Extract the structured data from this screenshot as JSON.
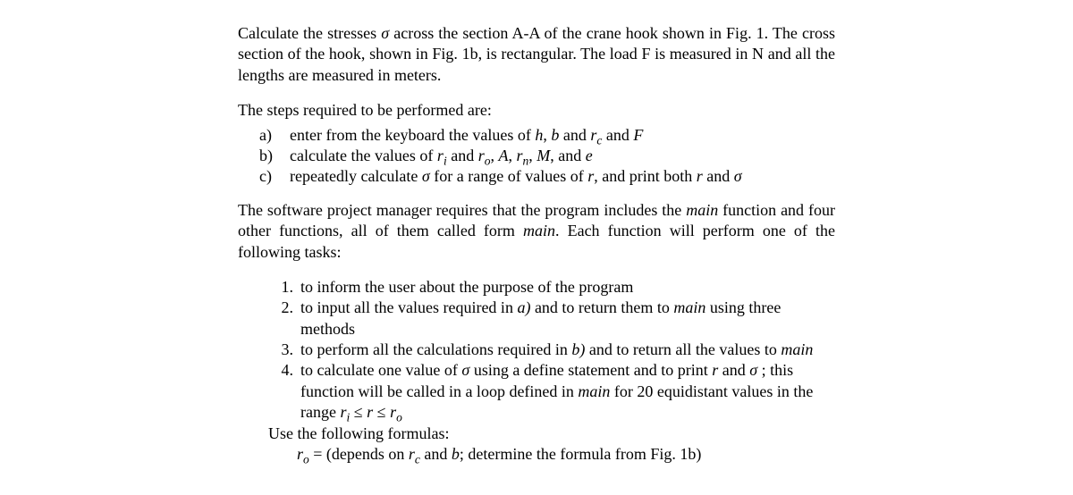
{
  "intro": {
    "p1_a": "Calculate the stresses ",
    "sigma1": "σ",
    "p1_b": " across the section A-A of the crane hook shown in Fig. 1. The cross section of the hook, shown in Fig. 1b, is rectangular.  The load F is measured in N and all the lengths are measured in meters."
  },
  "stepsHeader": "The steps required to be performed are:",
  "steps": {
    "a": {
      "marker": "a)",
      "pre": "enter from the keyboard the values of ",
      "h": "h",
      "comma1": ", ",
      "b": "b",
      "and1": " and ",
      "rc": "r",
      "rc_sub": "c",
      "and2": " and ",
      "F": "F"
    },
    "b": {
      "marker": "b)",
      "pre": "calculate the values of ",
      "ri": "r",
      "ri_sub": "i",
      "and1": " and ",
      "ro": "r",
      "ro_sub": "o",
      "c1": ", ",
      "A": "A",
      "c2": ", ",
      "rn": "r",
      "rn_sub": "n",
      "c3": ", ",
      "M": "M",
      "c4": ", and ",
      "e": "e"
    },
    "c": {
      "marker": "c)",
      "pre": "repeatedly calculate ",
      "sigma": "σ",
      "mid": " for a range of values of ",
      "r": "r",
      "mid2": ", and print both ",
      "r2": "r",
      "and": " and ",
      "sigma2": "σ"
    }
  },
  "pmPara": {
    "a": "The software project manager requires that the program includes the ",
    "main1": "main",
    "b": " function and four other functions, all of them called form ",
    "main2": "main",
    "c": ".  Each function will perform one of the following tasks:"
  },
  "tasks": {
    "t1": {
      "marker": "1.",
      "text": "to inform the user about the purpose of the program"
    },
    "t2": {
      "marker": "2.",
      "pre": "to input all the values required in ",
      "a": "a)",
      "post": " and to return them to ",
      "main": "main",
      "post2": " using three methods"
    },
    "t3": {
      "marker": "3.",
      "pre": "to perform all the calculations required in ",
      "b": "b)",
      "post": " and to return all the values to ",
      "main": "main"
    },
    "t4": {
      "marker": "4.",
      "pre": "to calculate one value of ",
      "sigma": "σ",
      "mid1": " using a define statement and to print ",
      "r": "r",
      "and": " and ",
      "sigma2": "σ",
      "semi": " ; this function will be called in a loop defined in ",
      "main": "main",
      "mid2": " for 20 equidistant values in the range ",
      "ri": "r",
      "ri_sub": "i",
      "le1": " ≤ ",
      "rr": "r",
      "le2": " ≤ ",
      "ro": "r",
      "ro_sub": "o"
    }
  },
  "useLine": "Use the following formulas:",
  "formula": {
    "ro": "r",
    "ro_sub": "o",
    "eq": " = (depends on ",
    "rc": "r",
    "rc_sub": "c",
    "and": " and ",
    "b": "b",
    "tail": "; determine the formula from  Fig. 1b)"
  }
}
